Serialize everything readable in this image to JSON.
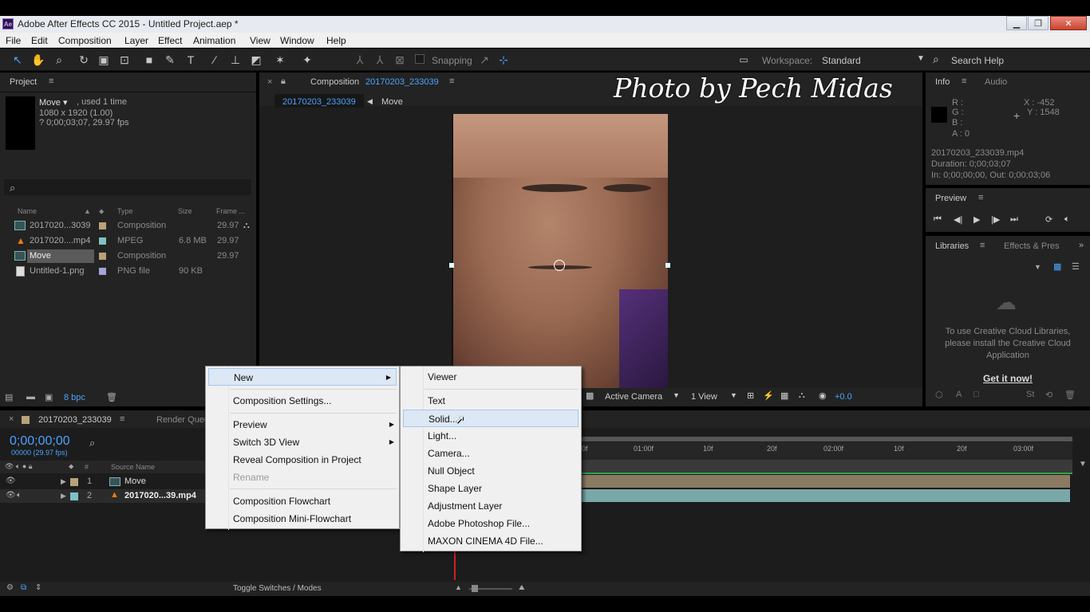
{
  "window": {
    "title": "Adobe After Effects CC 2015 - Untitled Project.aep *",
    "app_badge": "Ae"
  },
  "menu": [
    "File",
    "Edit",
    "Composition",
    "Layer",
    "Effect",
    "Animation",
    "View",
    "Window",
    "Help"
  ],
  "toolbar": {
    "snapping": "Snapping",
    "workspace_label": "Workspace:",
    "workspace_value": "Standard",
    "search_help": "Search Help"
  },
  "project": {
    "title": "Project",
    "item_name": "Move",
    "used": ", used 1 time",
    "dims": "1080 x 1920 (1.00)",
    "duration": "? 0;00;03;07, 29.97 fps",
    "columns": {
      "name": "Name",
      "type": "Type",
      "size": "Size",
      "frame": "Frame ..."
    },
    "rows": [
      {
        "name": "2017020...3039",
        "type": "Composition",
        "size": "",
        "frame": "29.97",
        "color": "#b8a27a"
      },
      {
        "name": "2017020....mp4",
        "type": "MPEG",
        "size": "6.8 MB",
        "frame": "29.97",
        "color": "#7fc2c2"
      },
      {
        "name": "Move",
        "type": "Composition",
        "size": "",
        "frame": "29.97",
        "color": "#b8a27a"
      },
      {
        "name": "Untitled-1.png",
        "type": "PNG file",
        "size": "90 KB",
        "frame": "",
        "color": "#a3a3d6"
      }
    ],
    "bpc": "8 bpc"
  },
  "composition": {
    "panel_label": "Composition",
    "comp_name": "20170203_233039",
    "tab_active": "20170203_233039",
    "breadcrumb": "Move",
    "watermark": "Photo by Pech Midas",
    "camera": "Active Camera",
    "views": "1 View",
    "exposure": "+0.0"
  },
  "info": {
    "tab_info": "Info",
    "tab_audio": "Audio",
    "r": "R :",
    "g": "G :",
    "b": "B :",
    "a": "A : 0",
    "x": "X : -452",
    "y": "Y : 1548",
    "file": "20170203_233039.mp4",
    "duration": "Duration: 0;00;03;07",
    "inout": "In: 0;00;00;00, Out: 0;00;03;06"
  },
  "preview": {
    "title": "Preview"
  },
  "libraries": {
    "tab": "Libraries",
    "tab2": "Effects & Pres",
    "message": "To use Creative Cloud Libraries, please install the Creative Cloud Application",
    "link": "Get it now!"
  },
  "timeline": {
    "tab": "20170203_233039",
    "render_tab": "Render Queu",
    "timecode": "0;00;00;00",
    "fps": "00000 (29.97 fps)",
    "col_source": "Source Name",
    "col_num": "#",
    "layers": [
      {
        "num": "1",
        "name": "Move",
        "color": "#b8a27a"
      },
      {
        "num": "2",
        "name": "2017020...39.mp4",
        "color": "#7fc2c2"
      }
    ],
    "ruler": [
      "0f",
      "01:00f",
      "10f",
      "20f",
      "02:00f",
      "10f",
      "20f",
      "03:00f"
    ],
    "toggle": "Toggle Switches / Modes"
  },
  "context_menu": {
    "items": [
      {
        "label": "New",
        "submenu": true
      },
      {
        "label": "Composition Settings...",
        "submenu": false
      },
      {
        "label": "Preview",
        "submenu": true
      },
      {
        "label": "Switch 3D View",
        "submenu": true
      },
      {
        "label": "Reveal Composition in Project",
        "submenu": false
      },
      {
        "label": "Rename",
        "submenu": false,
        "disabled": true
      },
      {
        "label": "Composition Flowchart",
        "submenu": false
      },
      {
        "label": "Composition Mini-Flowchart",
        "submenu": false
      }
    ]
  },
  "submenu": {
    "items": [
      "Viewer",
      "Text",
      "Solid...",
      "Light...",
      "Camera...",
      "Null Object",
      "Shape Layer",
      "Adjustment Layer",
      "Adobe Photoshop File...",
      "MAXON CINEMA 4D File..."
    ],
    "hover": "Solid..."
  }
}
